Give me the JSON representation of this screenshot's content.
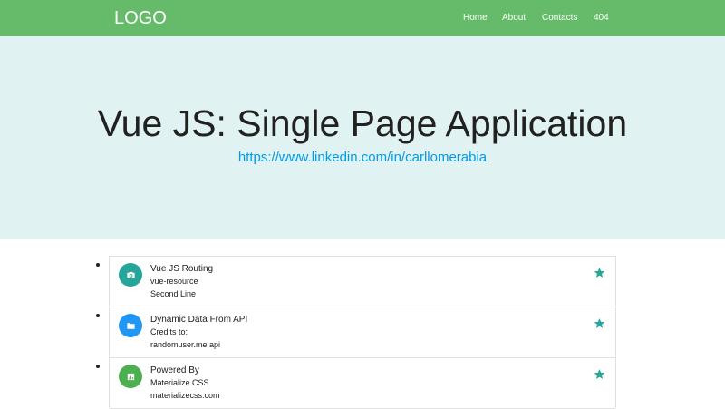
{
  "navbar": {
    "logo": "LOGO",
    "links": [
      "Home",
      "About",
      "Contacts",
      "404"
    ]
  },
  "hero": {
    "title": "Vue JS: Single Page Application",
    "link": "https://www.linkedin.com/in/carllomerabia"
  },
  "collection": {
    "items": [
      {
        "title": "Vue JS Routing",
        "line1": "vue-resource",
        "line2": "Second Line",
        "icon": "camera-icon",
        "color": "#26a69a"
      },
      {
        "title": "Dynamic Data From API",
        "line1": "Credits to:",
        "line2": "randomuser.me api",
        "icon": "folder-icon",
        "color": "#2196f3"
      },
      {
        "title": "Powered By",
        "line1": "Materialize CSS",
        "line2": "materializecss.com",
        "icon": "chart-icon",
        "color": "#4caf50"
      }
    ],
    "star_color": "#26a69a"
  }
}
